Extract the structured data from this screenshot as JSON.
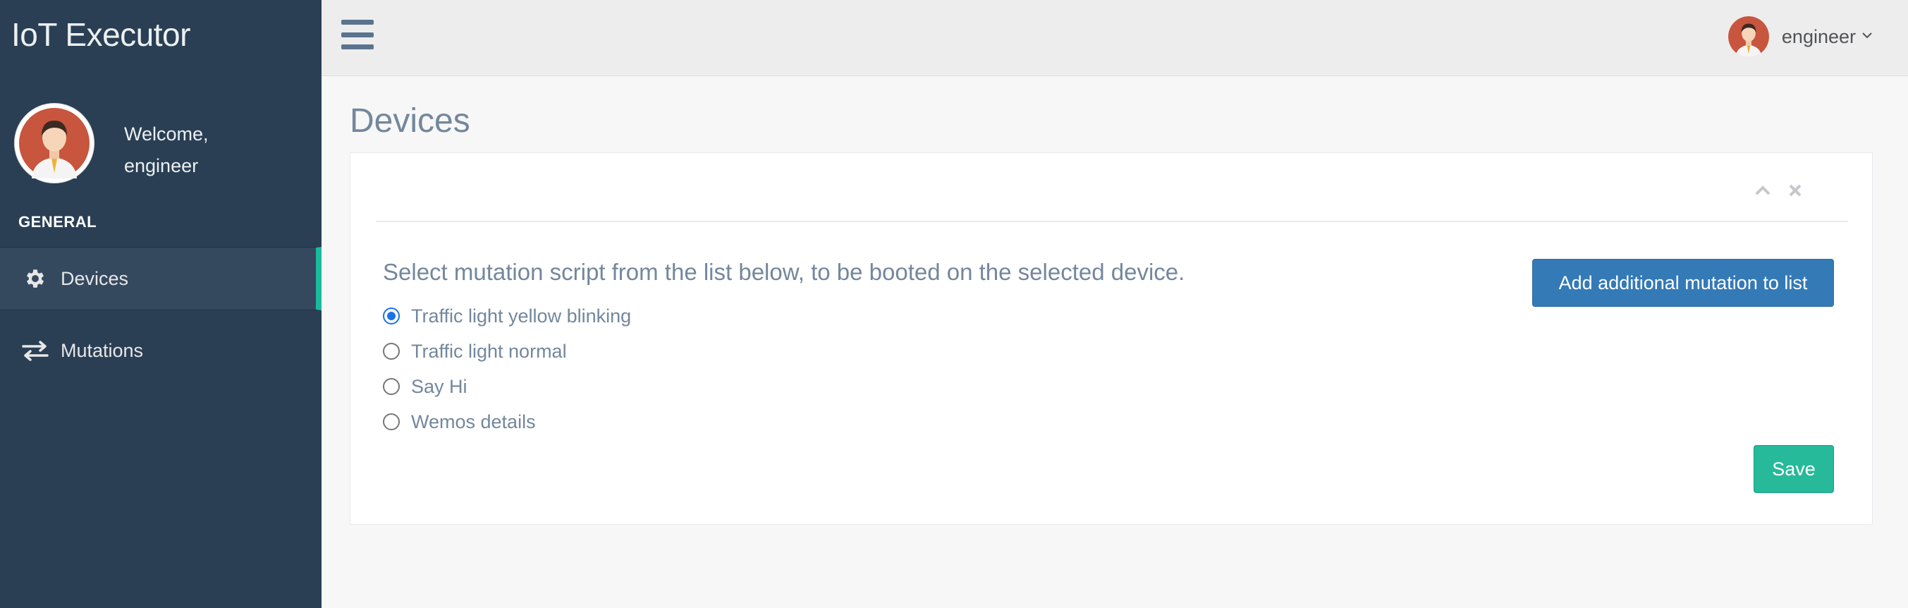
{
  "app": {
    "title": "IoT Executor"
  },
  "sidebar": {
    "welcome_line1": "Welcome,",
    "welcome_line2": "engineer",
    "section_title": "GENERAL",
    "items": [
      {
        "label": "Devices",
        "icon": "gear-icon",
        "active": true
      },
      {
        "label": "Mutations",
        "icon": "exchange-arrows-icon",
        "active": false
      }
    ]
  },
  "topbar": {
    "menu_icon": "hamburger-menu-icon",
    "user_name": "engineer",
    "caret_icon": "chevron-down-icon"
  },
  "page": {
    "title": "Devices",
    "prompt": "Select mutation script from the list below, to be booted on the selected device.",
    "options": [
      {
        "label": "Traffic light yellow blinking",
        "selected": true
      },
      {
        "label": "Traffic light normal",
        "selected": false
      },
      {
        "label": "Say Hi",
        "selected": false
      },
      {
        "label": "Wemos details",
        "selected": false
      }
    ],
    "add_button_label": "Add additional mutation to list",
    "save_button_label": "Save",
    "tools": [
      "chevron-up-icon",
      "close-icon"
    ]
  },
  "colors": {
    "sidebar_bg": "#2a3f54",
    "active_accent": "#1abb9c",
    "primary_button": "#337ab7",
    "success_button": "#26b99a"
  }
}
